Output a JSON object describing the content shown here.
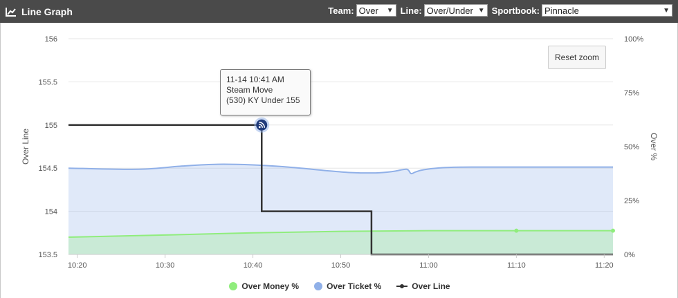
{
  "header": {
    "title": "Line Graph",
    "icon": "line-chart-icon"
  },
  "controls": {
    "team_label": "Team:",
    "team_value": "Over",
    "line_label": "Line:",
    "line_value": "Over/Under",
    "sportsbook_label": "Sportbook:",
    "sportsbook_value": "Pinnacle"
  },
  "reset_zoom_label": "Reset zoom",
  "tooltip": {
    "line1": "11-14 10:41 AM",
    "line2": "Steam Move",
    "line3": "(530) KY Under 155"
  },
  "legend": [
    {
      "label": "Over Money %",
      "color": "#90ed7d"
    },
    {
      "label": "Over Ticket %",
      "color": "#90b0e8"
    },
    {
      "label": "Over Line",
      "color": "#333333"
    }
  ],
  "chart_data": {
    "type": "line",
    "x_time_range": [
      "10:19",
      "11:21"
    ],
    "x_tick_labels": [
      "10:20",
      "10:30",
      "10:40",
      "10:50",
      "11:00",
      "11:10",
      "11:20"
    ],
    "y_left": {
      "label": "Over Line",
      "range": [
        153.5,
        156
      ],
      "ticks": [
        153.5,
        154,
        154.5,
        155,
        155.5,
        156
      ]
    },
    "y_right": {
      "label": "Over %",
      "range": [
        0,
        100
      ],
      "ticks": [
        "0%",
        "25%",
        "50%",
        "75%",
        "100%"
      ]
    },
    "grid": true,
    "legend_position": "bottom",
    "series": [
      {
        "name": "Over Ticket %",
        "axis": "right",
        "style": "area",
        "color": "#90b0e8",
        "x": [
          "10:19",
          "10:27",
          "10:32",
          "10:36",
          "10:40",
          "10:44",
          "10:48",
          "10:51",
          "10:54",
          "10:56",
          "10:57.5",
          "10:58",
          "10:58.5",
          "10:59.5",
          "11:02",
          "11:06",
          "11:21"
        ],
        "y": [
          40,
          39.5,
          41,
          41.8,
          41.5,
          40.5,
          39,
          38,
          37.8,
          38.5,
          39.5,
          37.5,
          38.2,
          39.3,
          40.3,
          40.5,
          40.5
        ]
      },
      {
        "name": "Over Money %",
        "axis": "right",
        "style": "area",
        "color": "#90ed7d",
        "x": [
          "10:19",
          "10:30",
          "10:40",
          "10:50",
          "11:00",
          "11:10",
          "11:21"
        ],
        "y": [
          8,
          9,
          10,
          10.7,
          11,
          11,
          11
        ]
      },
      {
        "name": "Over Line",
        "axis": "left",
        "style": "step",
        "color": "#333333",
        "x": [
          "10:19",
          "10:41",
          "10:41",
          "10:53.5",
          "10:53.5",
          "11:21"
        ],
        "y": [
          155,
          155,
          154,
          154,
          153.5,
          153.5
        ]
      }
    ],
    "annotations": [
      {
        "x": "10:41",
        "y": 155,
        "icon": "steam-move-icon",
        "text": [
          "11-14 10:41 AM",
          "Steam Move",
          "(530) KY Under 155"
        ]
      }
    ],
    "markers": [
      {
        "series": "Over Money %",
        "x": [
          "11:10",
          "11:21"
        ]
      }
    ]
  }
}
